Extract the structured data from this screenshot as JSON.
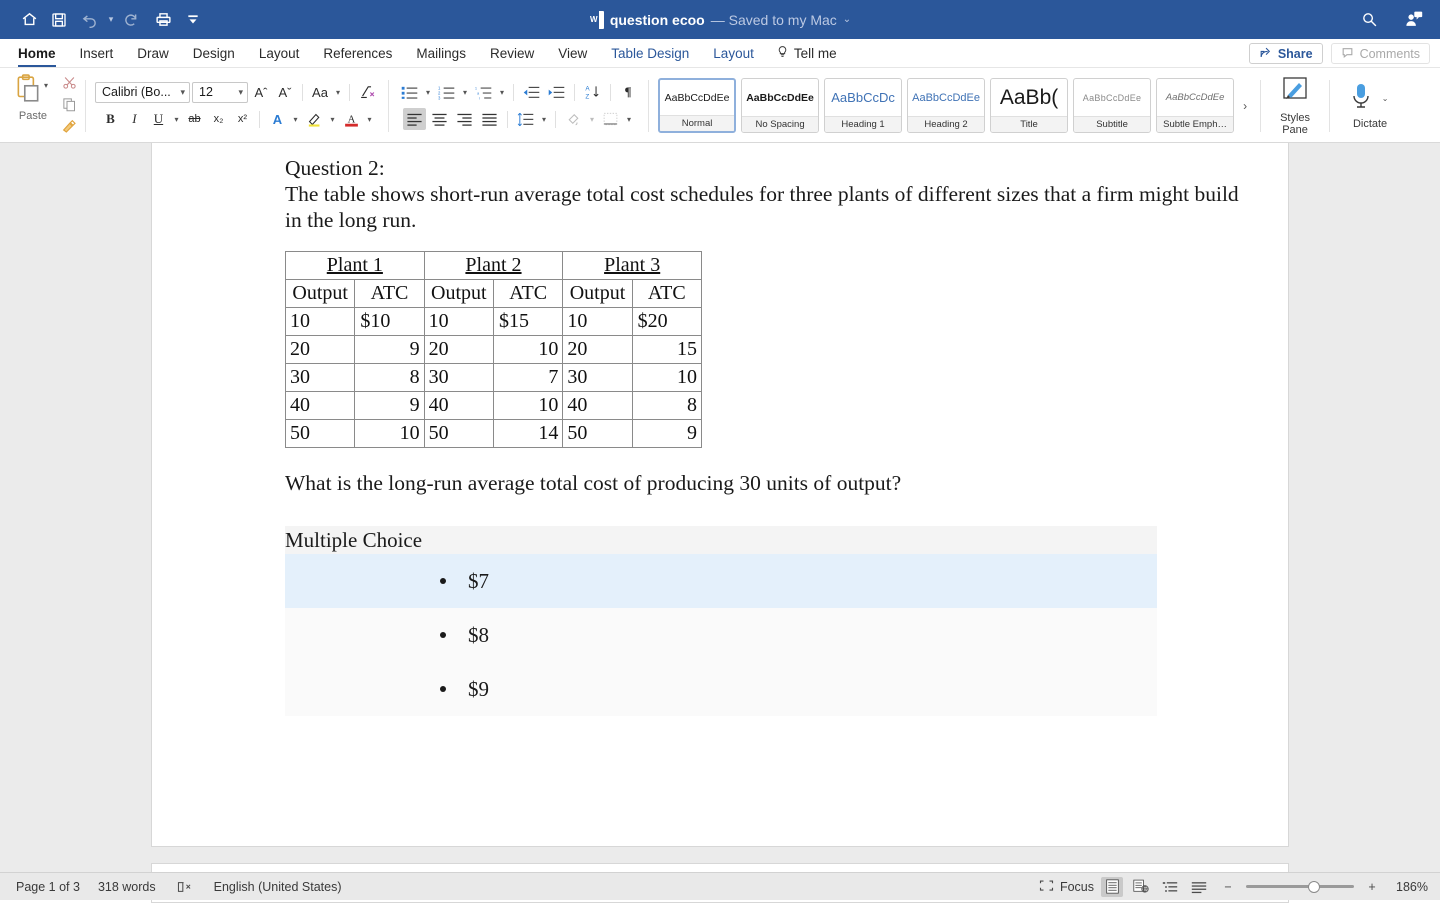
{
  "titlebar": {
    "icons": [
      "home-icon",
      "save-icon",
      "undo-icon",
      "redo-icon",
      "print-icon",
      "customize-toolbar-icon"
    ],
    "doc_name": "question ecoo",
    "saved_state": "— Saved to my Mac",
    "saved_caret": "⌄",
    "right_icons": [
      "search-icon",
      "collaborate-icon"
    ],
    "background": "#2b579a"
  },
  "tabs": [
    {
      "label": "Home",
      "active": true,
      "contextual": false
    },
    {
      "label": "Insert",
      "active": false,
      "contextual": false
    },
    {
      "label": "Draw",
      "active": false,
      "contextual": false
    },
    {
      "label": "Design",
      "active": false,
      "contextual": false
    },
    {
      "label": "Layout",
      "active": false,
      "contextual": false
    },
    {
      "label": "References",
      "active": false,
      "contextual": false
    },
    {
      "label": "Mailings",
      "active": false,
      "contextual": false
    },
    {
      "label": "Review",
      "active": false,
      "contextual": false
    },
    {
      "label": "View",
      "active": false,
      "contextual": false
    },
    {
      "label": "Table Design",
      "active": false,
      "contextual": true
    },
    {
      "label": "Layout",
      "active": false,
      "contextual": true
    }
  ],
  "tellme": {
    "label": "Tell me",
    "icon": "lightbulb-icon"
  },
  "share": {
    "label": "Share",
    "icon": "share-icon"
  },
  "comments": {
    "label": "Comments",
    "icon": "comment-icon"
  },
  "ribbon": {
    "paste": {
      "label": "Paste",
      "icon": "clipboard-icon",
      "cut": "scissors-icon",
      "copy": "copy-icon",
      "format_painter": "format-painter-icon"
    },
    "font": {
      "name_value": "Calibri (Bo...",
      "size_value": "12",
      "grow": "Aˆ",
      "shrink": "Aˇ",
      "change_case": "Aa",
      "clear_formatting": "clear-formatting-icon",
      "bold": "B",
      "italic": "I",
      "underline": "U",
      "strikethrough": "ab",
      "subscript": "x₂",
      "superscript": "x²",
      "text_effects": "A",
      "highlight": "highlight-icon",
      "font_color": "A"
    },
    "paragraph": {
      "bullets": "bullet-list-icon",
      "numbering": "numbered-list-icon",
      "multilevel": "multilevel-list-icon",
      "decrease_indent": "decrease-indent-icon",
      "increase_indent": "increase-indent-icon",
      "sort": "sort-icon",
      "show_marks": "¶",
      "align_left": "align-left-icon",
      "align_center": "align-center-icon",
      "align_right": "align-right-icon",
      "justify": "justify-icon",
      "line_spacing": "line-spacing-icon",
      "shading": "shading-icon",
      "borders": "borders-icon"
    },
    "styles": [
      {
        "preview": "AaBbCcDdEe",
        "name": "Normal",
        "selected": true
      },
      {
        "preview": "AaBbCcDdEe",
        "name": "No Spacing",
        "selected": false
      },
      {
        "preview": "AaBbCcDc",
        "name": "Heading 1",
        "selected": false
      },
      {
        "preview": "AaBbCcDdEе",
        "name": "Heading 2",
        "selected": false
      },
      {
        "preview": "AaBb(",
        "name": "Title",
        "selected": false
      },
      {
        "preview": "AaBbCcDdEe",
        "name": "Subtitle",
        "selected": false
      },
      {
        "preview": "AaBbCcDdEe",
        "name": "Subtle Emph…",
        "selected": false
      }
    ],
    "gallery_more": "›",
    "styles_pane": {
      "label": "Styles\nPane",
      "label_line1": "Styles",
      "label_line2": "Pane",
      "icon": "styles-pane-icon"
    },
    "dictate": {
      "label": "Dictate",
      "icon": "microphone-icon",
      "caret": "⌄"
    }
  },
  "document": {
    "question_label": "Question 2:",
    "intro": "The table shows short-run average total cost schedules for three plants of different sizes that a firm might build in the long run.",
    "table": {
      "plant_headers": [
        "Plant 1",
        "Plant 2",
        "Plant 3"
      ],
      "sub_headers": [
        "Output",
        "ATC",
        "Output",
        "ATC",
        "Output",
        "ATC"
      ],
      "rows": [
        [
          "10",
          "$10",
          "10",
          "$15",
          "10",
          "$20"
        ],
        [
          "20",
          "9",
          "20",
          "10",
          "20",
          "15"
        ],
        [
          "30",
          "8",
          "30",
          "7",
          "30",
          "10"
        ],
        [
          "40",
          "9",
          "40",
          "10",
          "40",
          "8"
        ],
        [
          "50",
          "10",
          "50",
          "14",
          "50",
          "9"
        ]
      ]
    },
    "question": "What is the long-run average total cost of producing 30 units of output?",
    "multiple_choice_label": "Multiple Choice",
    "choices": [
      {
        "text": "$7",
        "selected": true
      },
      {
        "text": "$8",
        "selected": false
      },
      {
        "text": "$9",
        "selected": false
      }
    ],
    "highlight_color": "#e4f0fb"
  },
  "statusbar": {
    "page": "Page 1 of 3",
    "words": "318 words",
    "proofing_icon": "proofing-icon",
    "language": "English (United States)",
    "focus": "Focus",
    "views": [
      "print-layout-icon",
      "web-layout-icon",
      "outline-icon",
      "draft-icon"
    ],
    "zoom_minus": "−",
    "zoom_plus": "+",
    "zoom_value": "186%"
  }
}
